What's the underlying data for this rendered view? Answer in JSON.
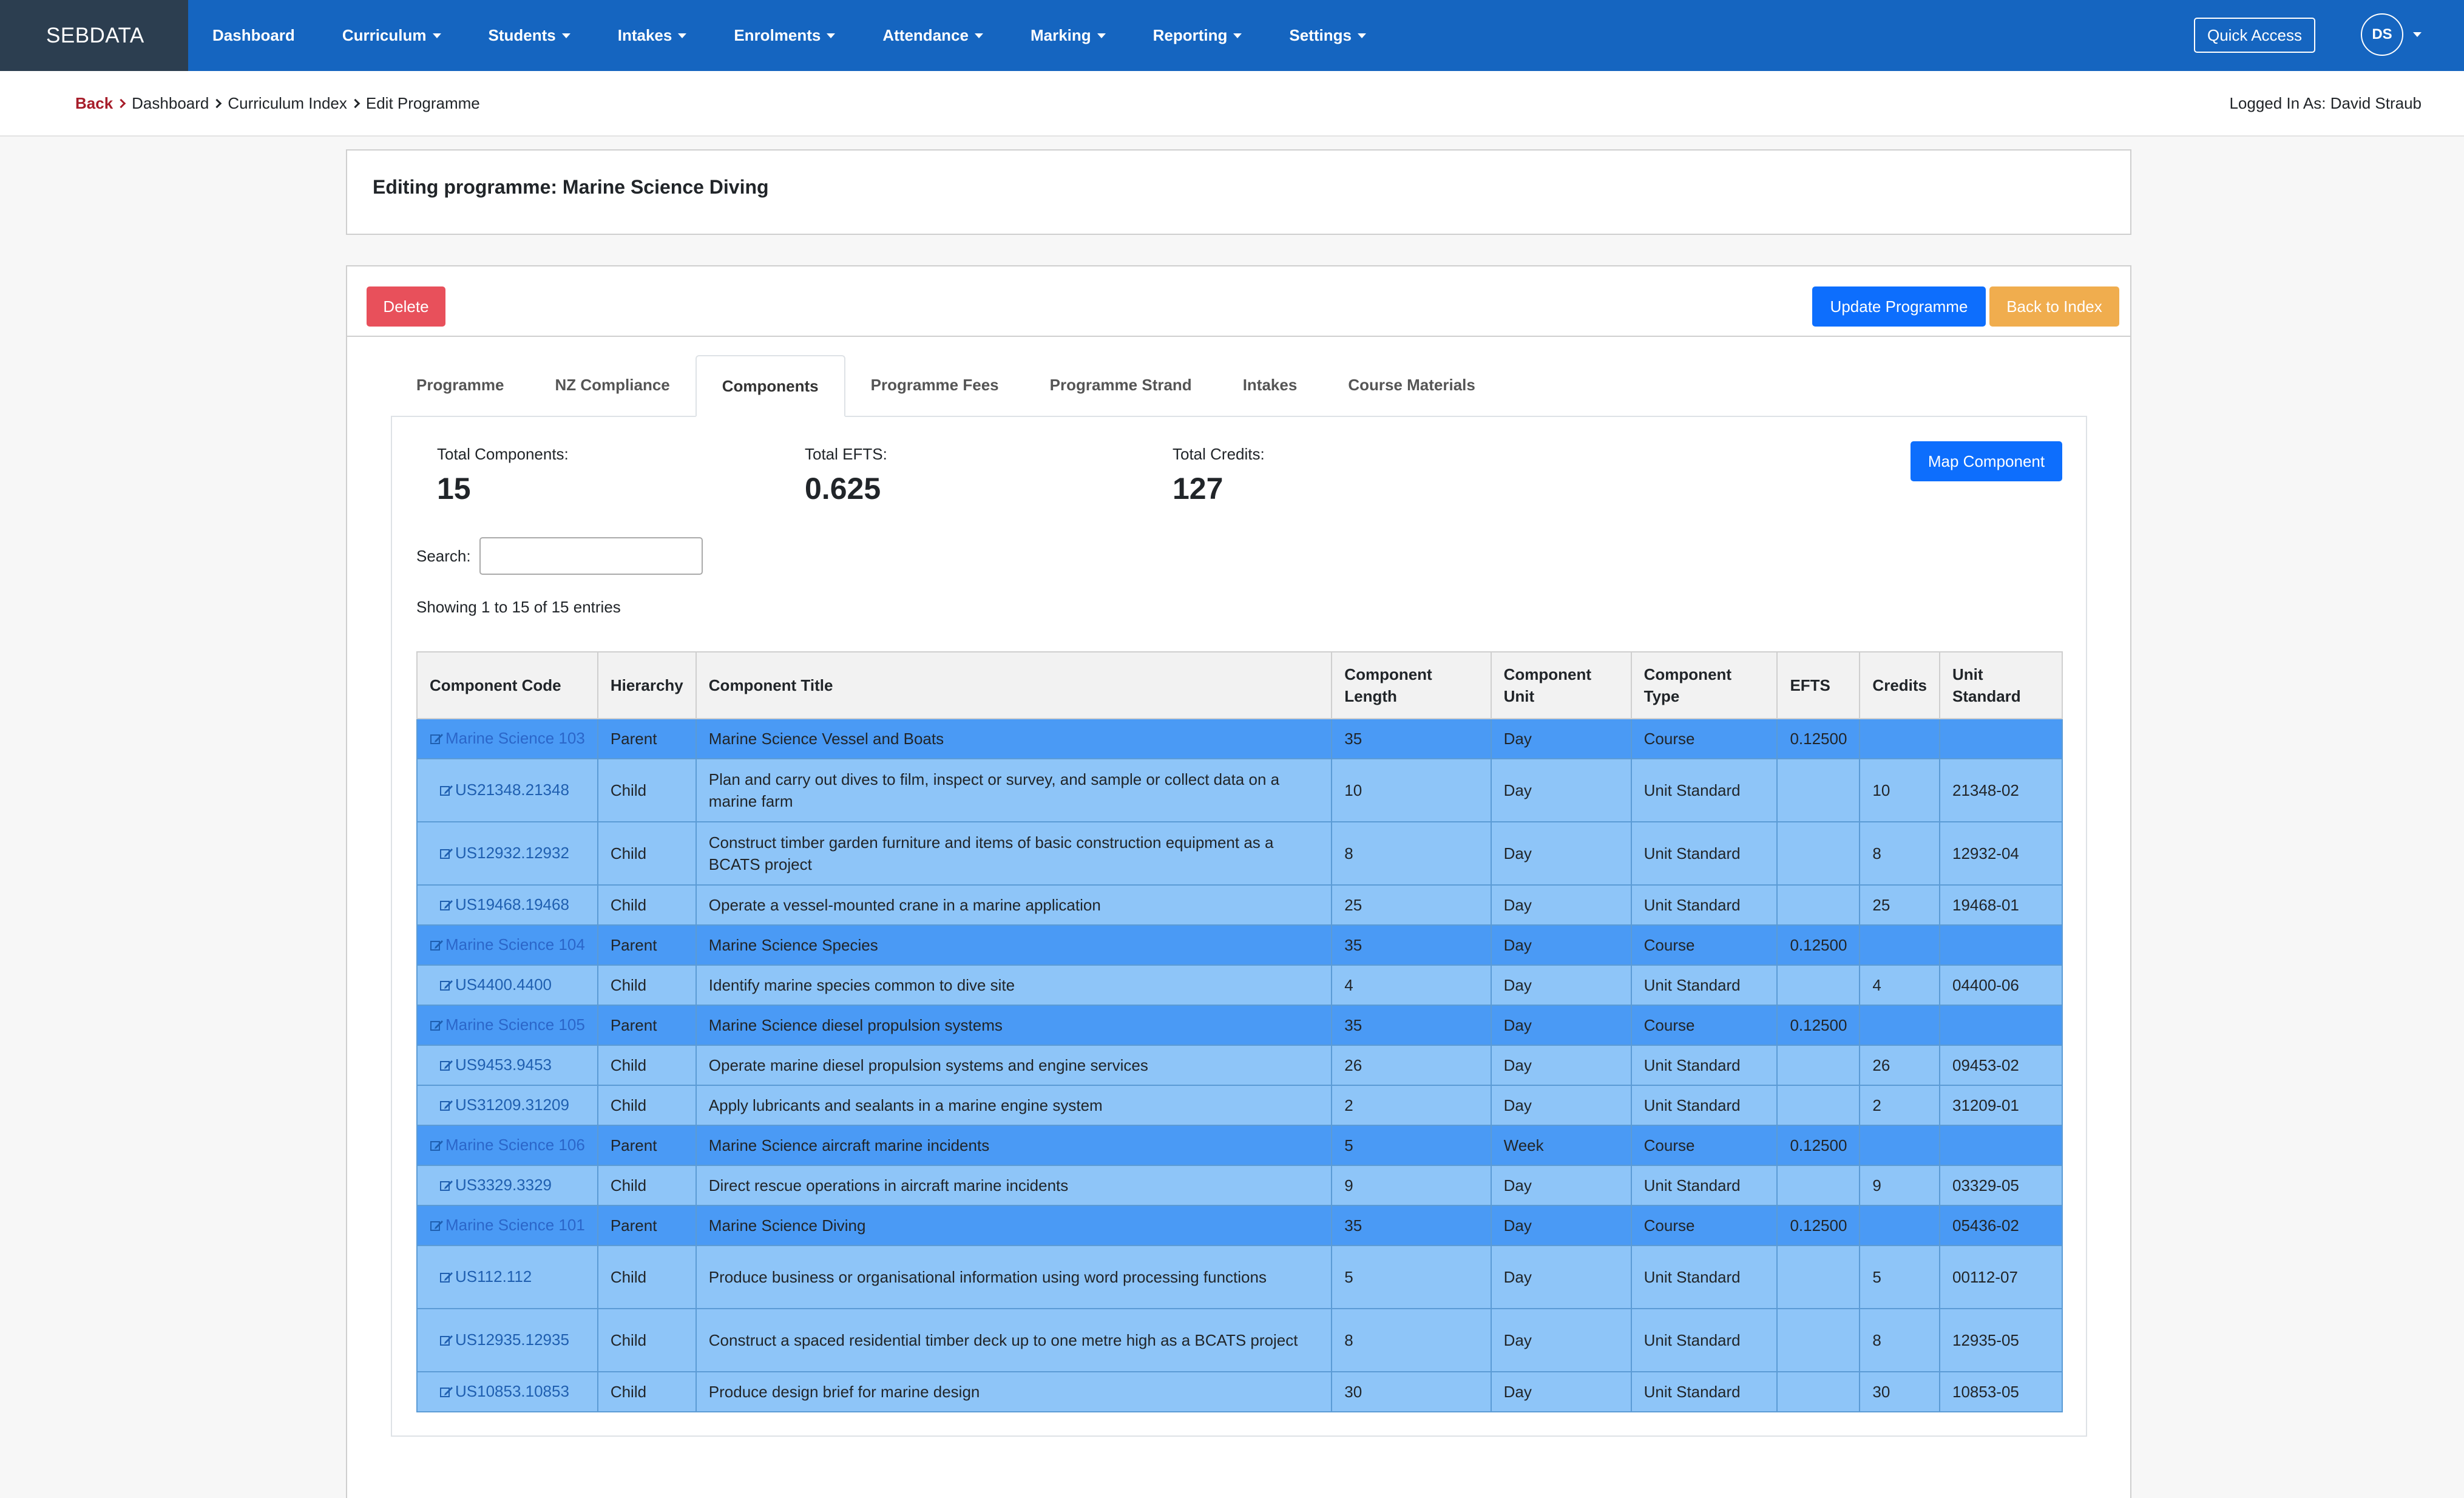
{
  "navbar": {
    "brand": "SEBDATA",
    "items": [
      {
        "label": "Dashboard",
        "dropdown": false
      },
      {
        "label": "Curriculum",
        "dropdown": true
      },
      {
        "label": "Students",
        "dropdown": true
      },
      {
        "label": "Intakes",
        "dropdown": true
      },
      {
        "label": "Enrolments",
        "dropdown": true
      },
      {
        "label": "Attendance",
        "dropdown": true
      },
      {
        "label": "Marking",
        "dropdown": true
      },
      {
        "label": "Reporting",
        "dropdown": true
      },
      {
        "label": "Settings",
        "dropdown": true
      }
    ],
    "quick_access": "Quick Access",
    "avatar_initials": "DS"
  },
  "breadcrumb": {
    "back": "Back",
    "items": [
      "Dashboard",
      "Curriculum Index",
      "Edit Programme"
    ]
  },
  "logged_in": "Logged In As: David Straub",
  "page_title": "Editing programme: Marine Science Diving",
  "actions": {
    "delete": "Delete",
    "update": "Update Programme",
    "back_to_index": "Back to Index"
  },
  "tabs": [
    {
      "label": "Programme",
      "active": false
    },
    {
      "label": "NZ Compliance",
      "active": false
    },
    {
      "label": "Components",
      "active": true
    },
    {
      "label": "Programme Fees",
      "active": false
    },
    {
      "label": "Programme Strand",
      "active": false
    },
    {
      "label": "Intakes",
      "active": false
    },
    {
      "label": "Course Materials",
      "active": false
    }
  ],
  "stats": {
    "total_components_label": "Total Components:",
    "total_components": "15",
    "total_efts_label": "Total EFTS:",
    "total_efts": "0.625",
    "total_credits_label": "Total Credits:",
    "total_credits": "127"
  },
  "map_component": "Map Component",
  "search": {
    "label": "Search:",
    "value": ""
  },
  "showing": "Showing 1 to 15 of 15 entries",
  "table": {
    "headers": [
      {
        "l1": "Component Code",
        "l2": ""
      },
      {
        "l1": "Hierarchy",
        "l2": ""
      },
      {
        "l1": "Component Title",
        "l2": ""
      },
      {
        "l1": "Component",
        "l2": "Length"
      },
      {
        "l1": "Component",
        "l2": "Unit"
      },
      {
        "l1": "Component",
        "l2": "Type"
      },
      {
        "l1": "EFTS",
        "l2": ""
      },
      {
        "l1": "Credits",
        "l2": ""
      },
      {
        "l1": "Unit",
        "l2": "Standard"
      }
    ],
    "rows": [
      {
        "code": "Marine Science 103",
        "hierarchy": "Parent",
        "title": "Marine Science Vessel and Boats",
        "length": "35",
        "unit": "Day",
        "type": "Course",
        "efts": "0.12500",
        "credits": "",
        "unit_standard": ""
      },
      {
        "code": "US21348.21348",
        "hierarchy": "Child",
        "title": "Plan and carry out dives to film, inspect or survey, and sample or collect data on a marine farm",
        "length": "10",
        "unit": "Day",
        "type": "Unit Standard",
        "efts": "",
        "credits": "10",
        "unit_standard": "21348-02"
      },
      {
        "code": "US12932.12932",
        "hierarchy": "Child",
        "title": "Construct timber garden furniture and items of basic construction equipment as a BCATS project",
        "length": "8",
        "unit": "Day",
        "type": "Unit Standard",
        "efts": "",
        "credits": "8",
        "unit_standard": "12932-04"
      },
      {
        "code": "US19468.19468",
        "hierarchy": "Child",
        "title": "Operate a vessel-mounted crane in a marine application",
        "length": "25",
        "unit": "Day",
        "type": "Unit Standard",
        "efts": "",
        "credits": "25",
        "unit_standard": "19468-01"
      },
      {
        "code": "Marine Science 104",
        "hierarchy": "Parent",
        "title": "Marine Science Species",
        "length": "35",
        "unit": "Day",
        "type": "Course",
        "efts": "0.12500",
        "credits": "",
        "unit_standard": ""
      },
      {
        "code": "US4400.4400",
        "hierarchy": "Child",
        "title": "Identify marine species common to dive site",
        "length": "4",
        "unit": "Day",
        "type": "Unit Standard",
        "efts": "",
        "credits": "4",
        "unit_standard": "04400-06"
      },
      {
        "code": "Marine Science 105",
        "hierarchy": "Parent",
        "title": "Marine Science diesel propulsion systems",
        "length": "35",
        "unit": "Day",
        "type": "Course",
        "efts": "0.12500",
        "credits": "",
        "unit_standard": ""
      },
      {
        "code": "US9453.9453",
        "hierarchy": "Child",
        "title": "Operate marine diesel propulsion systems and engine services",
        "length": "26",
        "unit": "Day",
        "type": "Unit Standard",
        "efts": "",
        "credits": "26",
        "unit_standard": "09453-02"
      },
      {
        "code": "US31209.31209",
        "hierarchy": "Child",
        "title": "Apply lubricants and sealants in a marine engine system",
        "length": "2",
        "unit": "Day",
        "type": "Unit Standard",
        "efts": "",
        "credits": "2",
        "unit_standard": "31209-01"
      },
      {
        "code": "Marine Science 106",
        "hierarchy": "Parent",
        "title": "Marine Science aircraft marine incidents",
        "length": "5",
        "unit": "Week",
        "type": "Course",
        "efts": "0.12500",
        "credits": "",
        "unit_standard": ""
      },
      {
        "code": "US3329.3329",
        "hierarchy": "Child",
        "title": "Direct rescue operations in aircraft marine incidents",
        "length": "9",
        "unit": "Day",
        "type": "Unit Standard",
        "efts": "",
        "credits": "9",
        "unit_standard": "03329-05"
      },
      {
        "code": "Marine Science 101",
        "hierarchy": "Parent",
        "title": "Marine Science Diving",
        "length": "35",
        "unit": "Day",
        "type": "Course",
        "efts": "0.12500",
        "credits": "",
        "unit_standard": "05436-02"
      },
      {
        "code": "US112.112",
        "hierarchy": "Child",
        "title": "Produce business or organisational information using word processing functions",
        "length": "5",
        "unit": "Day",
        "type": "Unit Standard",
        "efts": "",
        "credits": "5",
        "unit_standard": "00112-07"
      },
      {
        "code": "US12935.12935",
        "hierarchy": "Child",
        "title": "Construct a spaced residential timber deck up to one metre high as a BCATS project",
        "length": "8",
        "unit": "Day",
        "type": "Unit Standard",
        "efts": "",
        "credits": "8",
        "unit_standard": "12935-05"
      },
      {
        "code": "US10853.10853",
        "hierarchy": "Child",
        "title": "Produce design brief for marine design",
        "length": "30",
        "unit": "Day",
        "type": "Unit Standard",
        "efts": "",
        "credits": "30",
        "unit_standard": "10853-05"
      }
    ]
  },
  "colors": {
    "navbar": "#1565c0",
    "brand_bg": "#2c3e50",
    "parent_row": "#4a9af5",
    "child_row": "#8ec5f8",
    "primary": "#0d6efd",
    "danger": "#e8505b",
    "warning": "#f0ad4e",
    "back_link": "#a71d2a"
  }
}
